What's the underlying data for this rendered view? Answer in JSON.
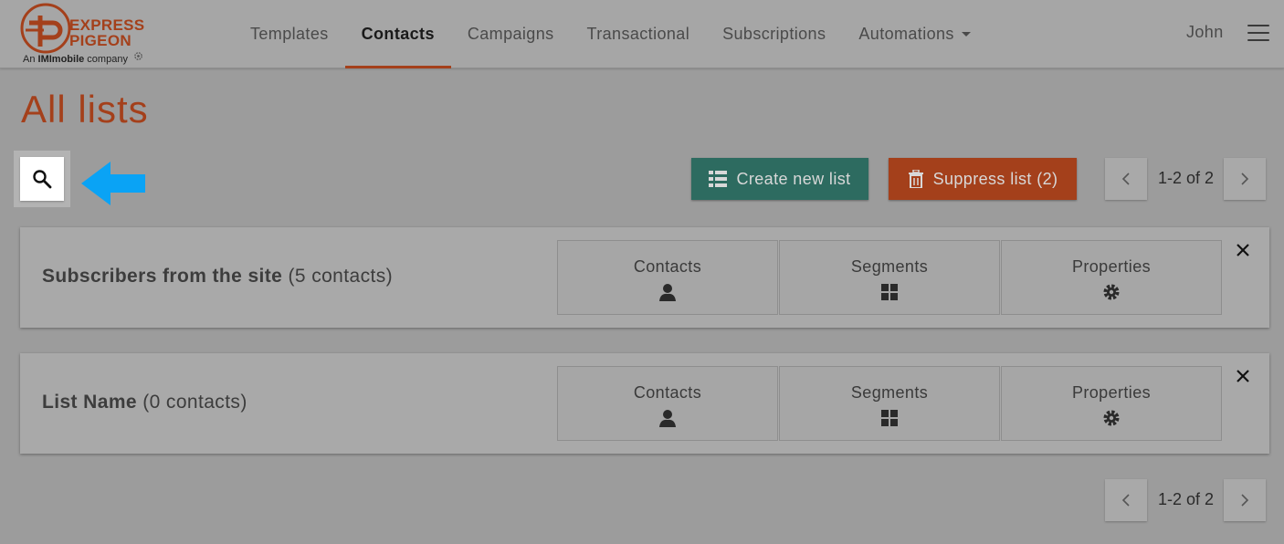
{
  "brand": {
    "name_line1": "EXPRESS",
    "name_line2": "PIGEON",
    "tagline_prefix": "An ",
    "tagline_brand": "IMImobile",
    "tagline_suffix": " company",
    "color": "#a4401b"
  },
  "nav": {
    "items": [
      {
        "label": "Templates",
        "active": false
      },
      {
        "label": "Contacts",
        "active": true
      },
      {
        "label": "Campaigns",
        "active": false
      },
      {
        "label": "Transactional",
        "active": false
      },
      {
        "label": "Subscriptions",
        "active": false
      },
      {
        "label": "Automations",
        "active": false,
        "has_dropdown": true
      }
    ],
    "user": "John",
    "menu_icon": "hamburger-icon"
  },
  "page": {
    "title": "All lists"
  },
  "toolbar": {
    "search_icon": "search-icon",
    "annotation_arrow_color": "#0aa3f5",
    "create_label": "Create new list",
    "create_color": "#2d6b60",
    "suppress_label": "Suppress list (2)",
    "suppress_color": "#a4401b"
  },
  "pagination": {
    "text": "1-2 of 2"
  },
  "lists": [
    {
      "name": "Subscribers from the site",
      "count": "(5 contacts)",
      "tabs": [
        {
          "label": "Contacts",
          "icon": "user-icon"
        },
        {
          "label": "Segments",
          "icon": "grid-icon"
        },
        {
          "label": "Properties",
          "icon": "gear-icon"
        }
      ]
    },
    {
      "name": "List Name",
      "count": "(0 contacts)",
      "tabs": [
        {
          "label": "Contacts",
          "icon": "user-icon"
        },
        {
          "label": "Segments",
          "icon": "grid-icon"
        },
        {
          "label": "Properties",
          "icon": "gear-icon"
        }
      ]
    }
  ]
}
